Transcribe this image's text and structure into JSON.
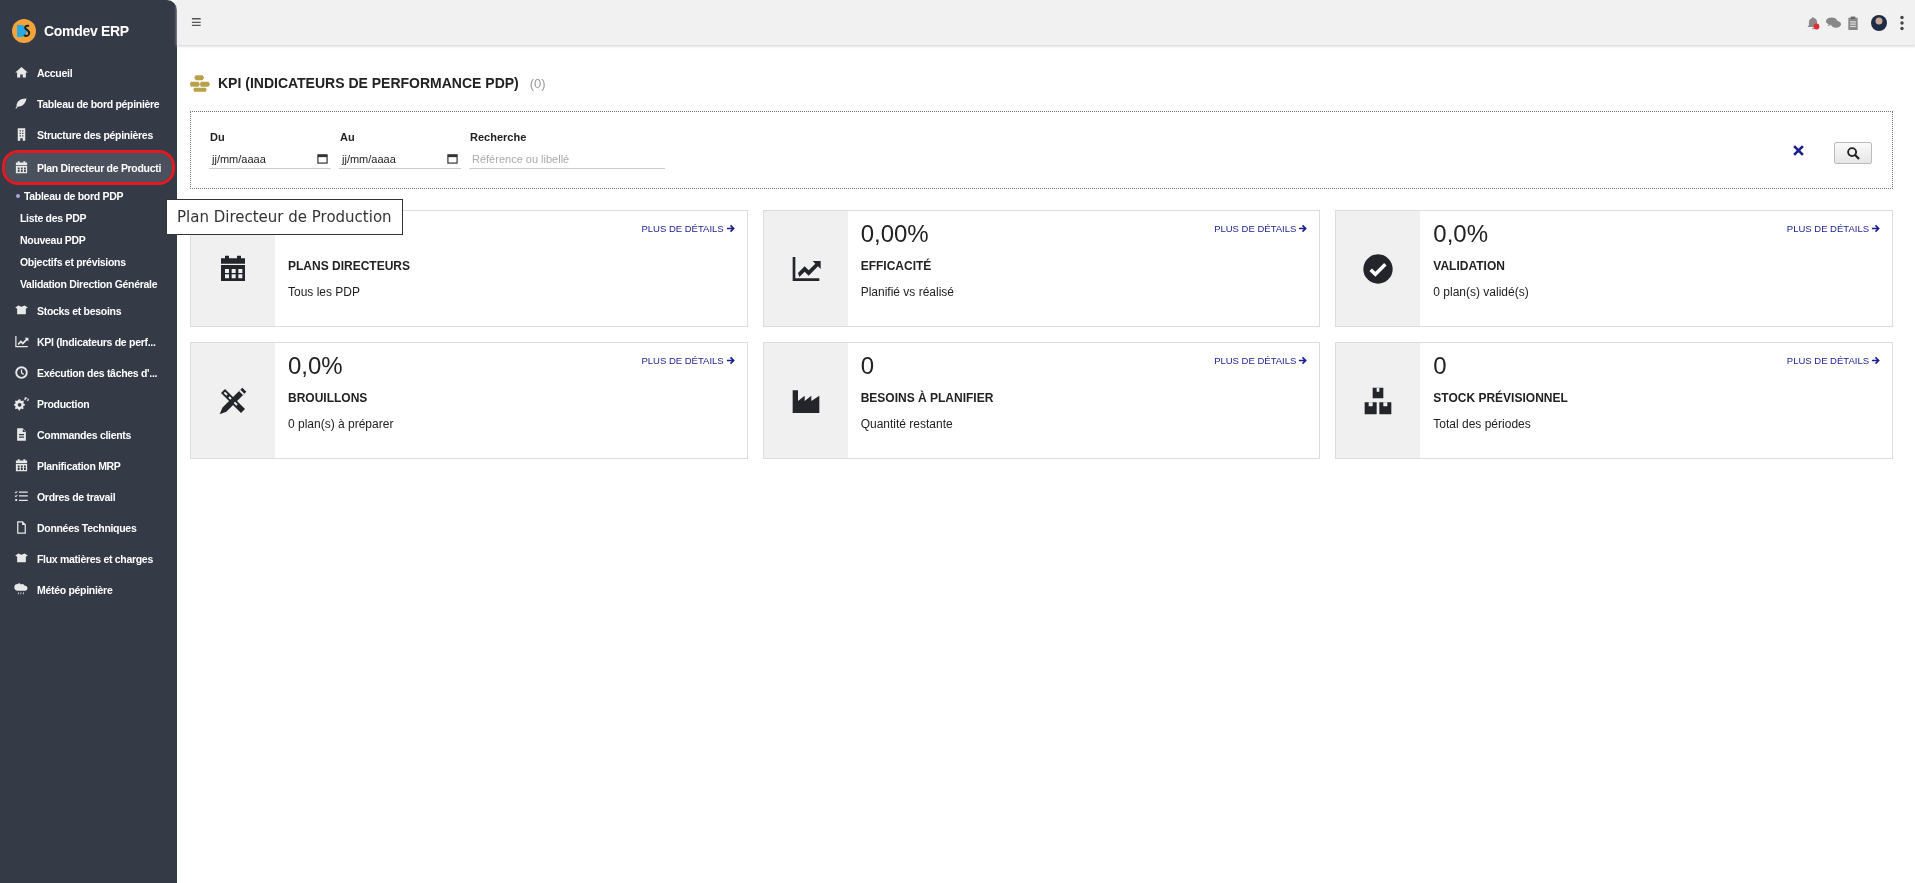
{
  "app": {
    "name": "Comdev ERP"
  },
  "sidebar": {
    "items": [
      {
        "label": "Accueil",
        "selected": false
      },
      {
        "label": "Tableau de bord pépinière",
        "selected": false
      },
      {
        "label": "Structure des pépinières",
        "selected": false
      },
      {
        "label": "Plan Directeur de Producti",
        "selected": true,
        "children": [
          {
            "label": "Tableau de bord PDP",
            "selected": true
          },
          {
            "label": "Liste des PDP",
            "selected": false
          },
          {
            "label": "Nouveau PDP",
            "selected": false
          },
          {
            "label": "Objectifs et prévisions",
            "selected": false
          },
          {
            "label": "Validation Direction Générale",
            "selected": false
          }
        ]
      },
      {
        "label": "Stocks et besoins",
        "selected": false
      },
      {
        "label": "KPI (Indicateurs de perf...",
        "selected": false
      },
      {
        "label": "Exécution des tâches d'...",
        "selected": false
      },
      {
        "label": "Production",
        "selected": false
      },
      {
        "label": "Commandes clients",
        "selected": false
      },
      {
        "label": "Planification MRP",
        "selected": false
      },
      {
        "label": "Ordres de travail",
        "selected": false
      },
      {
        "label": "Données Techniques",
        "selected": false
      },
      {
        "label": "Flux matières et charges",
        "selected": false
      },
      {
        "label": "Météo pépinière",
        "selected": false
      }
    ]
  },
  "header": {
    "menu_icon": "≡",
    "notifications": true
  },
  "page": {
    "title": "KPI (INDICATEURS DE PERFORMANCE PDP)",
    "count": "(0)"
  },
  "filters": {
    "fields": [
      {
        "label": "Du",
        "placeholder": "jj/mm/aaaa",
        "kind": "date"
      },
      {
        "label": "Au",
        "placeholder": "jj/mm/aaaa",
        "kind": "date"
      },
      {
        "label": "Recherche",
        "placeholder": "Référence ou libellé",
        "kind": "text"
      }
    ]
  },
  "cards": [
    {
      "title": "PLANS DIRECTEURS",
      "subtitle": "Tous les PDP",
      "link": "PLUS DE DÉTAILS"
    },
    {
      "value": "0,00%",
      "title": "EFFICACITÉ",
      "subtitle": "Planifié vs réalisé",
      "link": "PLUS DE DÉTAILS"
    },
    {
      "value": "0,0%",
      "title": "VALIDATION",
      "subtitle": "0 plan(s) validé(s)",
      "link": "PLUS DE DÉTAILS"
    },
    {
      "value": "0,0%",
      "title": "BROUILLONS",
      "subtitle": "0 plan(s) à préparer",
      "link": "PLUS DE DÉTAILS"
    },
    {
      "value": "0",
      "title": "BESOINS À PLANIFIER",
      "subtitle": "Quantité restante",
      "link": "PLUS DE DÉTAILS"
    },
    {
      "value": "0",
      "title": "STOCK PRÉVISIONNEL",
      "subtitle": "Total des périodes",
      "link": "PLUS DE DÉTAILS"
    }
  ],
  "tooltip": {
    "text": "Plan Directeur de Production"
  }
}
